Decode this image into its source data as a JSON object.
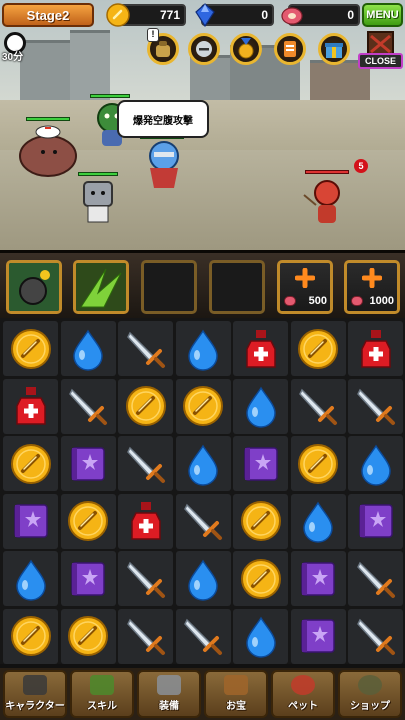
{
  "header": {
    "stage_label": "Stage2",
    "coins": "771",
    "gems": "0",
    "meat": "0",
    "menu_label": "MENU"
  },
  "battle": {
    "timer_label": "30分",
    "quest_badge": "!",
    "close_label": "CLOSE",
    "speech_text": "爆発空腹攻撃",
    "enemy_count": "5"
  },
  "skills": {
    "slot5_cost": "500",
    "slot6_cost": "1000"
  },
  "board": {
    "rows": [
      [
        "coin",
        "water",
        "sword",
        "water",
        "potion",
        "coin",
        "potion"
      ],
      [
        "potion",
        "sword",
        "coin",
        "coin",
        "water",
        "sword",
        "sword"
      ],
      [
        "coin",
        "book",
        "sword",
        "water",
        "book",
        "coin",
        "water"
      ],
      [
        "book",
        "coin",
        "potion",
        "sword",
        "coin",
        "water",
        "book"
      ],
      [
        "water",
        "book",
        "sword",
        "water",
        "coin",
        "book",
        "sword"
      ],
      [
        "coin",
        "coin",
        "sword",
        "sword",
        "water",
        "book",
        "sword"
      ]
    ]
  },
  "nav": {
    "items": [
      {
        "label": "キャラクター",
        "icon": "character-icon"
      },
      {
        "label": "スキル",
        "icon": "skill-icon"
      },
      {
        "label": "装備",
        "icon": "equipment-icon"
      },
      {
        "label": "お宝",
        "icon": "treasure-icon"
      },
      {
        "label": "ペット",
        "icon": "pet-icon"
      },
      {
        "label": "ショップ",
        "icon": "shop-icon"
      }
    ]
  },
  "colors": {
    "coin": "#f5b415",
    "water": "#2a8ff0",
    "potion": "#dd1c24",
    "book": "#7f3fc8",
    "sword": "#dde6ee",
    "hp_green": "#3ecf3e"
  }
}
